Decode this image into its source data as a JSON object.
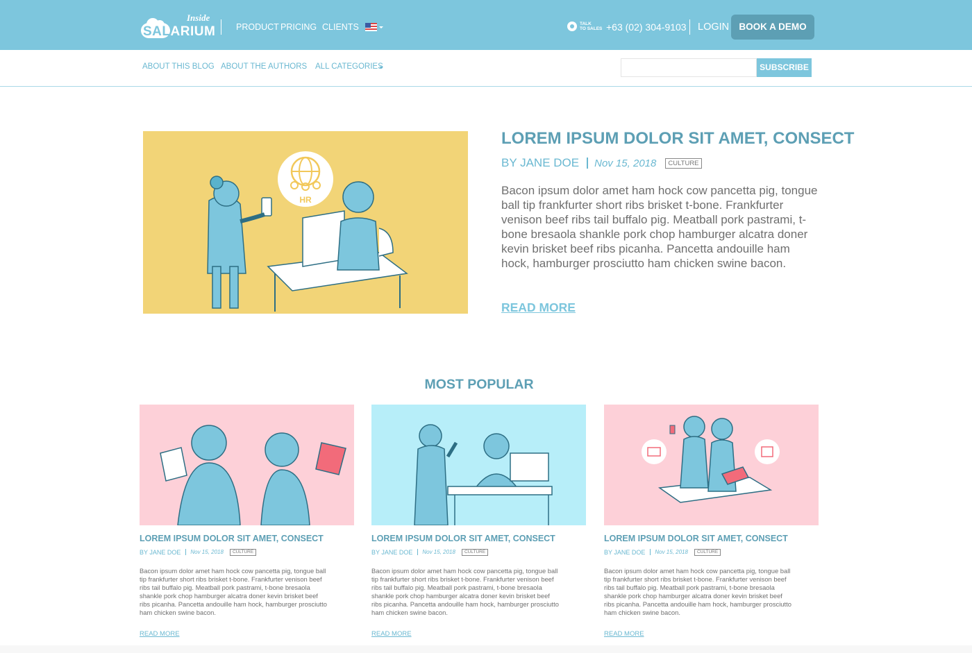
{
  "brand": {
    "logo_inside": "Inside",
    "logo_sal": "SAL",
    "logo_rest": "ARIUM",
    "colors": {
      "header": "#7dc6dd",
      "accent": "#5d9fb4",
      "link": "#6ab8d1",
      "button": "#5d9fb4"
    }
  },
  "topnav": {
    "items": [
      "PRODUCT",
      "PRICING",
      "CLIENTS"
    ],
    "flag_icon": "us-flag-icon",
    "talk_line1": "TALK",
    "talk_line2": "TO SALES",
    "phone": "+63 (02) 304-9103",
    "login": "LOGIN",
    "demo_button": "BOOK A DEMO"
  },
  "subnav": {
    "items": [
      "ABOUT THIS BLOG",
      "ABOUT THE AUTHORS",
      "ALL CATEGORIES"
    ],
    "subscribe_placeholder": "",
    "subscribe_button": "SUBSCRIBE"
  },
  "featured": {
    "title": "LOREM IPSUM DOLOR SIT AMET, CONSECT",
    "author": "BY JANE DOE",
    "date": "Nov 15, 2018",
    "tag": "CULTURE",
    "body": "Bacon ipsum dolor amet ham hock cow pancetta pig, tongue ball tip frankfurter short ribs brisket t-bone. Frankfurter venison beef ribs tail buffalo pig. Meatball pork pastrami, t-bone bresaola shankle pork chop hamburger alcatra doner kevin brisket beef ribs picanha. Pancetta andouille ham hock, hamburger prosciutto ham chicken swine bacon.",
    "read_more": "READ MORE",
    "image_badge": "HR"
  },
  "most_popular": {
    "heading": "MOST POPULAR",
    "cards": [
      {
        "title": "LOREM IPSUM DOLOR SIT AMET, CONSECT",
        "author": "BY JANE DOE",
        "date": "Nov 15, 2018",
        "tag": "CULTURE",
        "body": "Bacon ipsum dolor amet ham hock cow pancetta pig, tongue ball tip frankfurter short ribs brisket t-bone. Frankfurter venison beef ribs tail buffalo pig. Meatball pork pastrami, t-bone bresaola shankle pork chop hamburger alcatra doner kevin brisket beef ribs picanha. Pancetta andouille ham hock, hamburger prosciutto ham chicken swine bacon.",
        "read_more": "READ MORE",
        "image_bg": "#fdd0d8"
      },
      {
        "title": "LOREM IPSUM DOLOR SIT AMET, CONSECT",
        "author": "BY JANE DOE",
        "date": "Nov 15, 2018",
        "tag": "CULTURE",
        "body": "Bacon ipsum dolor amet ham hock cow pancetta pig, tongue ball tip frankfurter short ribs brisket t-bone. Frankfurter venison beef ribs tail buffalo pig. Meatball pork pastrami, t-bone bresaola shankle pork chop hamburger alcatra doner kevin brisket beef ribs picanha. Pancetta andouille ham hock, hamburger prosciutto ham chicken swine bacon.",
        "read_more": "READ MORE",
        "image_bg": "#b7eef9"
      },
      {
        "title": "LOREM IPSUM DOLOR SIT AMET, CONSECT",
        "author": "BY JANE DOE",
        "date": "Nov 15, 2018",
        "tag": "CULTURE",
        "body": "Bacon ipsum dolor amet ham hock cow pancetta pig, tongue ball tip frankfurter short ribs brisket t-bone. Frankfurter venison beef ribs tail buffalo pig. Meatball pork pastrami, t-bone bresaola shankle pork chop hamburger alcatra doner kevin brisket beef ribs picanha. Pancetta andouille ham hock, hamburger prosciutto ham chicken swine bacon.",
        "read_more": "READ MORE",
        "image_bg": "#fdd0d8"
      }
    ]
  }
}
